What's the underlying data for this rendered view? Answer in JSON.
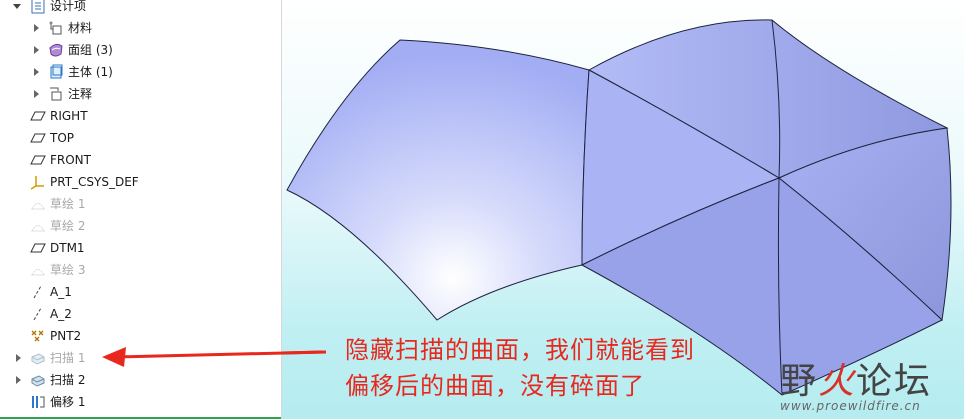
{
  "tree": {
    "items": [
      {
        "label": "设计项",
        "icon": "design-items-icon",
        "expander": "expanded",
        "dim": false
      },
      {
        "label": "材料",
        "icon": "material-icon",
        "expander": "collapsed",
        "dim": false
      },
      {
        "label": "面组 (3)",
        "icon": "quilt-icon",
        "expander": "collapsed",
        "dim": false
      },
      {
        "label": "主体 (1)",
        "icon": "body-icon",
        "expander": "collapsed",
        "dim": false
      },
      {
        "label": "注释",
        "icon": "annotation-icon",
        "expander": "collapsed",
        "dim": false
      },
      {
        "label": "RIGHT",
        "icon": "datum-plane-icon",
        "expander": "none",
        "dim": false
      },
      {
        "label": "TOP",
        "icon": "datum-plane-icon",
        "expander": "none",
        "dim": false
      },
      {
        "label": "FRONT",
        "icon": "datum-plane-icon",
        "expander": "none",
        "dim": false
      },
      {
        "label": "PRT_CSYS_DEF",
        "icon": "csys-icon",
        "expander": "none",
        "dim": false
      },
      {
        "label": "草绘 1",
        "icon": "sketch-icon",
        "expander": "none",
        "dim": true
      },
      {
        "label": "草绘 2",
        "icon": "sketch-icon",
        "expander": "none",
        "dim": true
      },
      {
        "label": "DTM1",
        "icon": "datum-plane-icon",
        "expander": "none",
        "dim": false
      },
      {
        "label": "草绘 3",
        "icon": "sketch-icon",
        "expander": "none",
        "dim": true
      },
      {
        "label": "A_1",
        "icon": "datum-axis-icon",
        "expander": "none",
        "dim": false
      },
      {
        "label": "A_2",
        "icon": "datum-axis-icon",
        "expander": "none",
        "dim": false
      },
      {
        "label": "PNT2",
        "icon": "datum-point-icon",
        "expander": "none",
        "dim": false
      },
      {
        "label": "扫描 1",
        "icon": "sweep-icon",
        "expander": "collapsed",
        "dim": true
      },
      {
        "label": "扫描 2",
        "icon": "sweep-icon",
        "expander": "collapsed",
        "dim": false
      },
      {
        "label": "偏移 1",
        "icon": "offset-icon",
        "expander": "none",
        "dim": false
      }
    ]
  },
  "annotation": {
    "line1": "隐藏扫描的曲面，我们就能看到",
    "line2": "偏移后的曲面，没有碎面了",
    "color": "#e8281c"
  },
  "watermark": {
    "part1": "野",
    "part2": "火",
    "part3": "论坛",
    "url": "www.proewildfire.cn"
  },
  "colors": {
    "surface": "#a9b3f6",
    "surface_edge": "#1e2240",
    "selection_green": "#2ea44f"
  }
}
